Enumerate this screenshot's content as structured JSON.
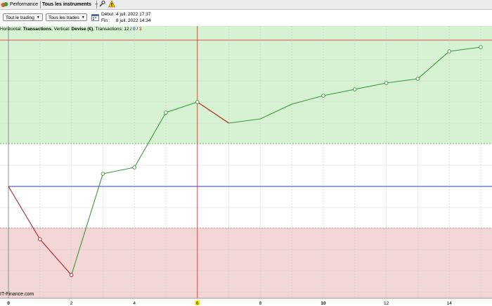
{
  "toolbar": {
    "performance_label": "Performance",
    "instruments_label": "Tous les instruments"
  },
  "filters": {
    "trading_select": "Tout le trading",
    "trades_select": "Tous les trades"
  },
  "dates": {
    "start_label": "Début :",
    "start_value": "4 juil. 2022 17:37",
    "end_label": "Fin :",
    "end_value": "8 juil. 2022 14:34"
  },
  "info": {
    "horizontal_prefix": "Horizontal: ",
    "horizontal_value": "Transactions",
    "vertical_prefix": ", Vertical: ",
    "vertical_value": "Devise (€)",
    "transactions_prefix": ", Transactions: ",
    "total": "12",
    "sep1": " / ",
    "winners": "0",
    "sep2": " / ",
    "losers": "3"
  },
  "watermark": "IT-Finance.com",
  "colors": {
    "profit_zone": "#d6f2d2",
    "loss_zone": "#f3d6d6",
    "up_line": "#3a9a3a",
    "down_line": "#b02020",
    "baseline": "#3333cc",
    "cursor": "#e03030"
  },
  "chart_data": {
    "type": "line",
    "x": [
      0,
      1,
      2,
      3,
      4,
      5,
      6,
      7,
      8,
      9,
      10,
      11,
      12,
      13,
      14,
      15
    ],
    "values": [
      0,
      -25,
      -42,
      6,
      9,
      35,
      40,
      30,
      32,
      39,
      43,
      46,
      49,
      51,
      64,
      66
    ],
    "x_ticks": [
      "0",
      "2",
      "4",
      "6",
      "8",
      "10",
      "12",
      "14"
    ],
    "highlighted_tick": "6",
    "bold_tick": "10",
    "baseline_value": 0,
    "cursor_x": 6,
    "grid": true
  }
}
